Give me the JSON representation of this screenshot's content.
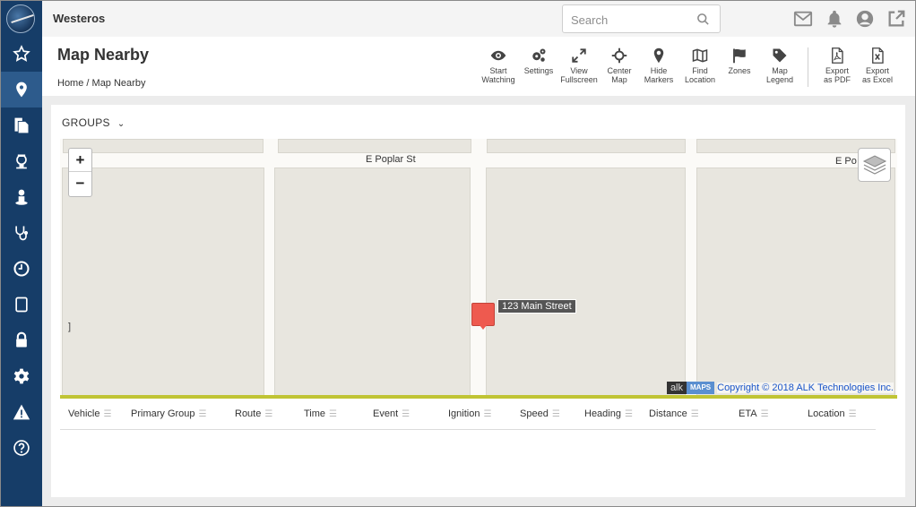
{
  "app": {
    "title": "Westeros"
  },
  "search": {
    "placeholder": "Search"
  },
  "top_icons": [
    "mail-icon",
    "bell-icon",
    "user-icon",
    "external-link-icon"
  ],
  "sidebar": {
    "active_index": 1,
    "items": [
      "star-icon",
      "location-pin-icon",
      "documents-icon",
      "driver-icon",
      "person-icon",
      "stethoscope-icon",
      "clock-icon",
      "tablet-icon",
      "lock-icon",
      "gear-icon",
      "warning-icon",
      "help-icon"
    ]
  },
  "page": {
    "title": "Map Nearby",
    "breadcrumb": {
      "home": "Home",
      "sep": "/",
      "current": "Map Nearby"
    }
  },
  "toolbar": {
    "items": [
      {
        "line1": "Start",
        "line2": "Watching",
        "icon": "eye-icon"
      },
      {
        "line1": "Settings",
        "line2": "",
        "icon": "cogs-icon"
      },
      {
        "line1": "View",
        "line2": "Fullscreen",
        "icon": "expand-icon"
      },
      {
        "line1": "Center",
        "line2": "Map",
        "icon": "crosshair-icon"
      },
      {
        "line1": "Hide",
        "line2": "Markers",
        "icon": "marker-icon"
      },
      {
        "line1": "Find",
        "line2": "Location",
        "icon": "map-icon"
      },
      {
        "line1": "Zones",
        "line2": "",
        "icon": "flag-icon"
      },
      {
        "line1": "Map",
        "line2": "Legend",
        "icon": "tag-icon"
      },
      {
        "line1": "Export",
        "line2": "as PDF",
        "icon": "pdf-file-icon"
      },
      {
        "line1": "Export",
        "line2": "as Excel",
        "icon": "excel-file-icon"
      }
    ]
  },
  "groups": {
    "label": "GROUPS"
  },
  "map": {
    "zoom_in": "+",
    "zoom_out": "−",
    "streets": [
      "E Poplar St",
      "E Po"
    ],
    "marker_label": "123 Main Street",
    "attribution": {
      "alk": "alk",
      "maps": "MAPS",
      "copyright": "Copyright © 2018 ALK Technologies Inc."
    },
    "left_stub": "]",
    "accent_color": "#c0c434",
    "marker_color": "#ee5a4f"
  },
  "table": {
    "columns": [
      "Vehicle",
      "Primary Group",
      "Route",
      "Time",
      "Event",
      "Ignition",
      "Speed",
      "Heading",
      "Distance",
      "ETA",
      "Location"
    ]
  }
}
